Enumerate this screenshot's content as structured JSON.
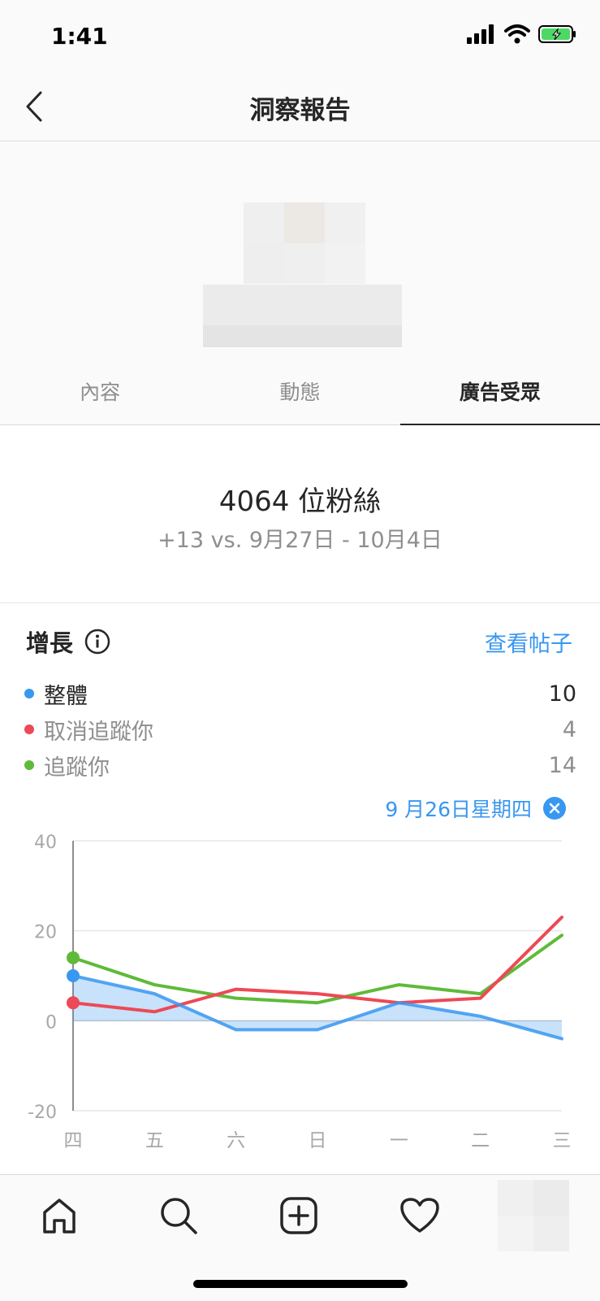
{
  "status_bar": {
    "time": "1:41"
  },
  "nav": {
    "title": "洞察報告"
  },
  "tabs": [
    {
      "label": "內容",
      "active": false
    },
    {
      "label": "動態",
      "active": false
    },
    {
      "label": "廣告受眾",
      "active": true
    }
  ],
  "summary": {
    "followers": "4064 位粉絲",
    "comparison": "+13 vs. 9月27日 - 10月4日"
  },
  "growth": {
    "title": "增長",
    "see_posts": "查看帖子",
    "legend": [
      {
        "label": "整體",
        "value": "10",
        "color": "#3897f0"
      },
      {
        "label": "取消追蹤你",
        "value": "4",
        "color": "#ed4956"
      },
      {
        "label": "追蹤你",
        "value": "14",
        "color": "#5fba3a"
      }
    ],
    "selected_date": "9 月26日星期四"
  },
  "chart_data": {
    "type": "line",
    "categories": [
      "四",
      "五",
      "六",
      "日",
      "一",
      "二",
      "三"
    ],
    "ylim": [
      -20,
      40
    ],
    "yticks": [
      "40",
      "20",
      "0",
      "-20"
    ],
    "series": [
      {
        "name": "整體",
        "color": "#3897f0",
        "values": [
          10,
          6,
          -2,
          -2,
          4,
          1,
          -4
        ]
      },
      {
        "name": "取消追蹤你",
        "color": "#ed4956",
        "values": [
          4,
          2,
          7,
          6,
          4,
          5,
          23
        ]
      },
      {
        "name": "追蹤你",
        "color": "#5fba3a",
        "values": [
          14,
          8,
          5,
          4,
          8,
          6,
          19
        ]
      }
    ]
  },
  "icons": {
    "back": "chevron-left-icon",
    "info": "info-icon",
    "close": "close-icon",
    "home": "home-icon",
    "search": "search-icon",
    "add": "add-post-icon",
    "heart": "heart-icon"
  }
}
